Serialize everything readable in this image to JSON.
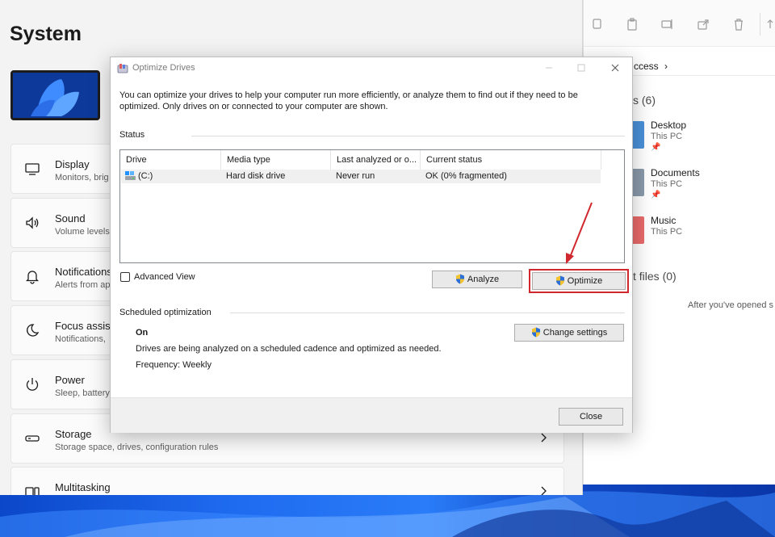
{
  "settings": {
    "title": "System",
    "items": [
      {
        "label": "Display",
        "sub": "Monitors, brig",
        "icon": "monitor-icon"
      },
      {
        "label": "Sound",
        "sub": "Volume levels",
        "icon": "speaker-icon"
      },
      {
        "label": "Notifications",
        "sub": "Alerts from ap",
        "icon": "bell-icon"
      },
      {
        "label": "Focus assist",
        "sub": "Notifications,",
        "icon": "moon-icon"
      },
      {
        "label": "Power",
        "sub": "Sleep, battery",
        "icon": "power-icon"
      },
      {
        "label": "Storage",
        "sub": "Storage space, drives, configuration rules",
        "icon": "drive-icon"
      },
      {
        "label": "Multitasking",
        "sub": "",
        "icon": "multitask-icon"
      }
    ]
  },
  "explorer": {
    "breadcrumb": "ccess",
    "quick_access_count": "s (6)",
    "folders": [
      {
        "name": "Desktop",
        "location": "This PC",
        "color": "#4a90d9"
      },
      {
        "name": "Documents",
        "location": "This PC",
        "color": "#8a9aab"
      },
      {
        "name": "Music",
        "location": "This PC",
        "color": "#e96a6a"
      }
    ],
    "recent_files": "t files (0)",
    "recent_empty": "After you've opened s"
  },
  "dialog": {
    "title": "Optimize Drives",
    "description": "You can optimize your drives to help your computer run more efficiently, or analyze them to find out if they need to be optimized. Only drives on or connected to your computer are shown.",
    "status_label": "Status",
    "columns": [
      "Drive",
      "Media type",
      "Last analyzed or o...",
      "Current status"
    ],
    "rows": [
      {
        "drive": "(C:)",
        "media_type": "Hard disk drive",
        "last_analyzed": "Never run",
        "status": "OK (0% fragmented)"
      }
    ],
    "advanced_view_label": "Advanced View",
    "analyze_label": "Analyze",
    "optimize_label": "Optimize",
    "scheduled_label": "Scheduled optimization",
    "schedule_state": "On",
    "change_settings_label": "Change settings",
    "schedule_desc": "Drives are being analyzed on a scheduled cadence and optimized as needed.",
    "frequency": "Frequency: Weekly",
    "close_label": "Close"
  },
  "colors": {
    "highlight_red": "#d0282e",
    "dialog_bg": "#ffffff",
    "settings_bg": "#f3f3f3"
  }
}
